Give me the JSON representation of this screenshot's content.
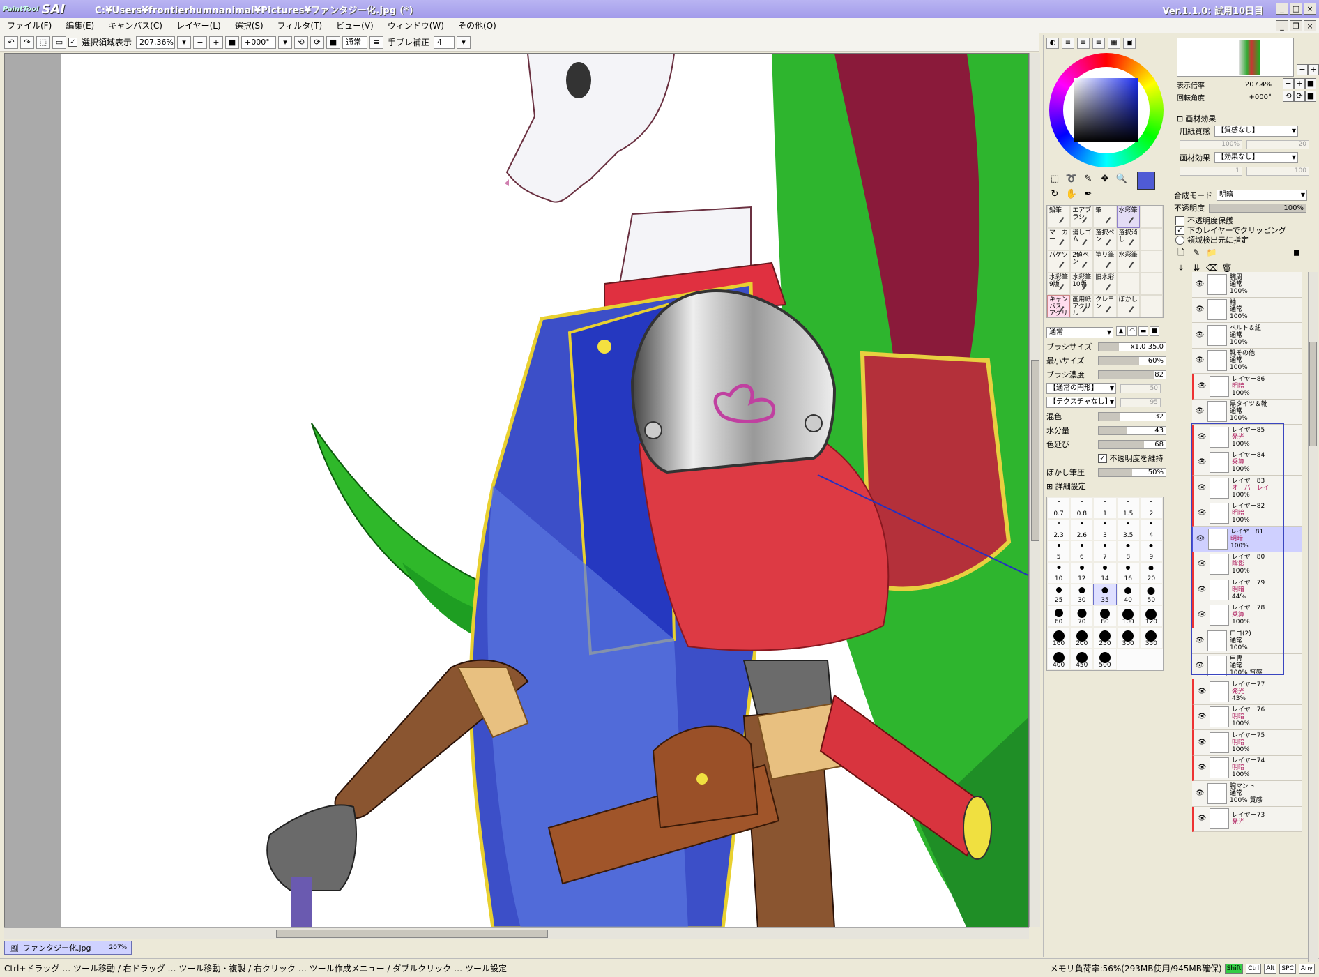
{
  "window": {
    "app_logo_top": "PaintTool",
    "app_logo": "SAI",
    "title": "C:¥Users¥frontierhumnanimal¥Pictures¥ファンタジー化.jpg (*)",
    "version": "Ver.1.1.0: 試用10日目",
    "min": "_",
    "max": "□",
    "close": "×"
  },
  "menu": [
    "ファイル(F)",
    "編集(E)",
    "キャンバス(C)",
    "レイヤー(L)",
    "選択(S)",
    "フィルタ(T)",
    "ビュー(V)",
    "ウィンドウ(W)",
    "その他(O)"
  ],
  "toolbar": {
    "selection_display": "選択領域表示",
    "zoom": "207.36%",
    "rotation": "+000°",
    "mode": "通常",
    "stabilizer_label": "手ブレ補正",
    "stabilizer": "4"
  },
  "document_tab": {
    "name": "ファンタジー化.jpg",
    "zoom": "207%"
  },
  "status": {
    "hint": "Ctrl+ドラッグ … ツール移動 / 右ドラッグ … ツール移動・複製 / 右クリック … ツール作成メニュー / ダブルクリック … ツール設定",
    "memory": "メモリ負荷率:56%(293MB使用/945MB確保)",
    "keys": [
      "Shift",
      "Ctrl",
      "Alt",
      "SPC",
      "Any"
    ],
    "keys_active": "Shift"
  },
  "color_panel": {
    "fg": "#4f5bd5",
    "bg": "#444444",
    "tools": [
      {
        "label": "鉛筆"
      },
      {
        "label": "エアブラシ"
      },
      {
        "label": "筆"
      },
      {
        "label": "水彩筆",
        "sel": true
      },
      {
        "label": ""
      },
      {
        "label": "マーカー"
      },
      {
        "label": "消しゴム"
      },
      {
        "label": "選択ペン"
      },
      {
        "label": "選択消し"
      },
      {
        "label": ""
      },
      {
        "label": "バケツ"
      },
      {
        "label": "2値ペン"
      },
      {
        "label": "塗り筆"
      },
      {
        "label": "水彩筆"
      },
      {
        "label": ""
      },
      {
        "label": "水彩筆 9版"
      },
      {
        "label": "水彩筆 10版"
      },
      {
        "label": "旧水彩"
      },
      {
        "label": ""
      },
      {
        "label": ""
      },
      {
        "label": "キャンバス アクリル",
        "sel2": true
      },
      {
        "label": "画用紙 アクリル"
      },
      {
        "label": "クレヨン"
      },
      {
        "label": "ぼかし"
      },
      {
        "label": ""
      }
    ],
    "blend": "通常",
    "brush_size_label": "ブラシサイズ",
    "brush_size_mult": "x1.0",
    "brush_size": "35.0",
    "min_size_label": "最小サイズ",
    "min_size": "60%",
    "density_label": "ブラシ濃度",
    "density": "82",
    "shape": "【通常の円形】",
    "shape_val": "50",
    "texture": "【テクスチャなし】",
    "texture_val": "95",
    "mix_label": "混色",
    "mix": "32",
    "water_label": "水分量",
    "water": "43",
    "stretch_label": "色延び",
    "stretch": "68",
    "keep_opacity": "不透明度を維持",
    "blur_label": "ぼかし筆圧",
    "blur": "50%",
    "detail": "詳細設定",
    "sizes": [
      "0.7",
      "0.8",
      "1",
      "1.5",
      "2",
      "2.3",
      "2.6",
      "3",
      "3.5",
      "4",
      "5",
      "6",
      "7",
      "8",
      "9",
      "10",
      "12",
      "14",
      "16",
      "20",
      "25",
      "30",
      "35",
      "40",
      "50",
      "60",
      "70",
      "80",
      "100",
      "120",
      "160",
      "200",
      "250",
      "300",
      "350",
      "400",
      "450",
      "500"
    ],
    "size_selected": "35"
  },
  "navigator": {
    "zoom_label": "表示倍率",
    "zoom": "207.4%",
    "angle_label": "回転角度",
    "angle": "+000°"
  },
  "layer_panel": {
    "material_title": "画材効果",
    "paper_label": "用紙質感",
    "paper": "【質感なし】",
    "paper_scale": "100%",
    "paper_strength": "20",
    "effect_label": "画材効果",
    "effect": "【効果なし】",
    "effect_width": "1",
    "effect_strength": "100",
    "blend_label": "合成モード",
    "blend": "明暗",
    "opacity_label": "不透明度",
    "opacity": "100%",
    "protect": "不透明度保護",
    "clip": "下のレイヤーでクリッピング",
    "source": "領域検出元に指定",
    "layers": [
      {
        "name": "腕周",
        "mode": "通常",
        "op": "100%",
        "style": ""
      },
      {
        "name": "袖",
        "mode": "通常",
        "op": "100%",
        "style": ""
      },
      {
        "name": "ベルト＆紐",
        "mode": "通常",
        "op": "100%",
        "style": ""
      },
      {
        "name": "靴その他",
        "mode": "通常",
        "op": "100%",
        "style": ""
      },
      {
        "name": "レイヤー86",
        "mode": "明暗",
        "op": "100%",
        "style": "clip",
        "hl": true
      },
      {
        "name": "黒タイツ＆靴",
        "mode": "通常",
        "op": "100%",
        "style": ""
      },
      {
        "name": "レイヤー85",
        "mode": "発光",
        "op": "100%",
        "style": "clip",
        "hl": true
      },
      {
        "name": "レイヤー84",
        "mode": "乗算",
        "op": "100%",
        "style": "clip",
        "hl": true
      },
      {
        "name": "レイヤー83",
        "mode": "オーバーレイ",
        "op": "100%",
        "style": "clip",
        "hl": true
      },
      {
        "name": "レイヤー82",
        "mode": "明暗",
        "op": "100%",
        "style": "clip",
        "hl": true
      },
      {
        "name": "レイヤー81",
        "mode": "明暗",
        "op": "100%",
        "style": "sel",
        "hl": true
      },
      {
        "name": "レイヤー80",
        "mode": "陰影",
        "op": "100%",
        "style": "clip",
        "hl": true
      },
      {
        "name": "レイヤー79",
        "mode": "明暗",
        "op": "44%",
        "style": "clip",
        "hl": true
      },
      {
        "name": "レイヤー78",
        "mode": "乗算",
        "op": "100%",
        "style": "clip",
        "hl": true
      },
      {
        "name": "ロゴ(2)",
        "mode": "通常",
        "op": "100%",
        "style": ""
      },
      {
        "name": "甲冑",
        "mode": "通常",
        "op": "100% 質感",
        "style": ""
      },
      {
        "name": "レイヤー77",
        "mode": "発光",
        "op": "43%",
        "style": "clip",
        "hl": true
      },
      {
        "name": "レイヤー76",
        "mode": "明暗",
        "op": "100%",
        "style": "clip",
        "hl": true
      },
      {
        "name": "レイヤー75",
        "mode": "明暗",
        "op": "100%",
        "style": "clip",
        "hl": true
      },
      {
        "name": "レイヤー74",
        "mode": "明暗",
        "op": "100%",
        "style": "clip",
        "hl": true
      },
      {
        "name": "腕マント",
        "mode": "通常",
        "op": "100% 質感",
        "style": ""
      },
      {
        "name": "レイヤー73",
        "mode": "発光",
        "op": "",
        "style": "clip",
        "hl": true
      }
    ]
  }
}
